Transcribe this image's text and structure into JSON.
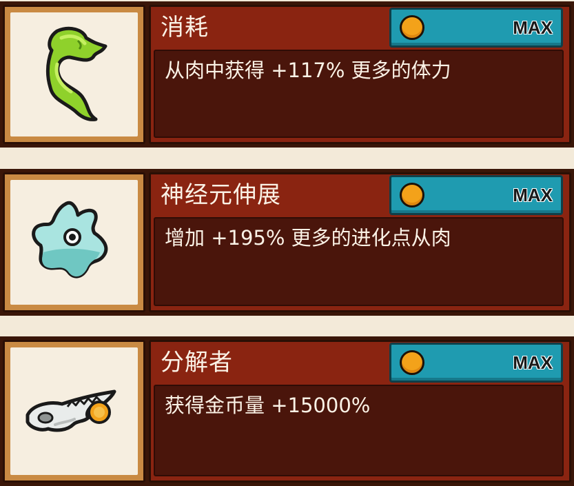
{
  "colors": {
    "panel": "#8a2411",
    "desc_box": "#4a150b",
    "button": "#1f9bb0",
    "coin": "#f3a21a",
    "frame": "#c98a43"
  },
  "upgrades": [
    {
      "title": "消耗",
      "description": "从肉中获得 +117% 更多的体力",
      "button_label": "MAX",
      "icon": "green-slime-worm-icon"
    },
    {
      "title": "神经元伸展",
      "description": "增加 +195% 更多的进化点从肉",
      "button_label": "MAX",
      "icon": "blue-amoeba-cell-icon"
    },
    {
      "title": "分解者",
      "description": "获得金币量 +15000%",
      "button_label": "MAX",
      "icon": "fish-skull-with-coin-icon"
    }
  ]
}
